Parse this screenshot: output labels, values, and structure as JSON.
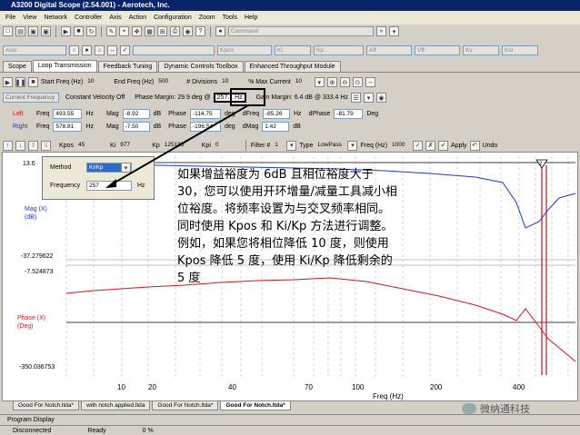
{
  "window": {
    "title": "A3200 Digital Scope (2.54.001) - Aerotech, Inc."
  },
  "menu": [
    "File",
    "View",
    "Network",
    "Controller",
    "Axis",
    "Action",
    "Configuration",
    "Zoom",
    "Tools",
    "Help"
  ],
  "toolbar2": {
    "axis_placeholder": "Axis",
    "command_placeholder": "Command",
    "kpos": "Kpos",
    "ki": "Ki",
    "kp": "Kp",
    "aff": "Aff",
    "vff": "Vff",
    "kv": "Kv",
    "ksi": "Ksi"
  },
  "tabs": [
    "Scope",
    "Loop Transmission",
    "Feedback Tuning",
    "Dynamic Controls Toolbox",
    "Enhanced Throughput Module"
  ],
  "freq_row": {
    "start_label": "Start Freq (Hz)",
    "start_value": "10",
    "end_label": "End Freq (Hz)",
    "end_value": "500",
    "div_label": "# Divisions",
    "div_value": "10",
    "max_label": "% Max Current",
    "max_value": "10"
  },
  "mode_row": {
    "current_freq": "Current Frequency",
    "cv_off": "Constant Velocity Off",
    "phase_margin": "Phase Margin: 29.9 deg @",
    "phase_freq": "257.1 Hz",
    "gain_margin": "Gain Margin: 6.4 dB @ 333.4 Hz"
  },
  "left": {
    "side": "Left",
    "freq_label": "Freq",
    "freq": "493.55",
    "hz": "Hz",
    "mag_label": "Mag",
    "mag": "-8.92",
    "db": "dB",
    "phase_label": "Phase",
    "phase": "-114.75",
    "deg": "deg",
    "dfreq_label": "dFreq",
    "dfreq": "-85.26",
    "dfreq_unit": "Hz",
    "dphase_label": "dPhase",
    "dphase": "-81.79",
    "dphase_unit": "Deg"
  },
  "right": {
    "side": "Right",
    "freq_label": "Freq",
    "freq": "578.81",
    "hz": "Hz",
    "mag_label": "Mag",
    "mag": "-7.50",
    "db": "dB",
    "phase_label": "Phase",
    "phase": "-196.54",
    "deg": "deg",
    "dmag_label": "dMag",
    "dmag": "1.42",
    "dmag_unit": "dB"
  },
  "filter_row": {
    "kpos_label": "Kpos",
    "kpos": "45",
    "ki_label": "Ki",
    "ki": "977",
    "kp_label": "Kp",
    "kp": "125183",
    "kpi_label": "Kpi",
    "kpi": "0",
    "filter_label": "Filter #",
    "filter": "1",
    "type_label": "Type",
    "type": "LowPass",
    "freq_label": "Freq (Hz)",
    "freq": "1000",
    "apply": "Apply",
    "undo": "Undo"
  },
  "popup": {
    "method_label": "Method",
    "method_value": "Ki/Kp",
    "freq_label": "Frequency",
    "freq_value": "257",
    "unit": "Hz"
  },
  "plot": {
    "mag_top": "13.6",
    "mag_label": "Mag (X)\n(dB)",
    "mag_bottom": "-37.279622",
    "phase_top": "-7.524873",
    "phase_label": "Phase (X)\n(Deg)",
    "phase_bottom": "-350.036753",
    "xlabel": "Freq (Hz)",
    "xticks": [
      "10",
      "20",
      "40",
      "70",
      "100",
      "200",
      "400"
    ],
    "cursor_marker": "2"
  },
  "annotation": "如果增益裕度为 6dB 且相位裕度大于 30，您可以使用开环增量/减量工具减小相位裕度。将频率设置为与交叉频率相同。同时使用 Kpos 和 Ki/Kp 方法进行调整。例如，如果您将相位降低 10 度，则使用 Kpos 降低 5 度，使用 Ki/Kp 降低剩余的 5 度",
  "bottom_tabs": [
    "Good For Notch.ltda*",
    "with notch applied.ltda",
    "Good For Notch.ltda*",
    "Good For Notch.ltda*"
  ],
  "status": {
    "program": "Program Display",
    "disconnected": "Disconnected",
    "ready": "Ready",
    "pct": "0 %"
  },
  "watermark": "微纳通科技",
  "colors": {
    "mag": "#1a3ad0",
    "phase": "#d01818",
    "cursor": "#c0102a"
  }
}
